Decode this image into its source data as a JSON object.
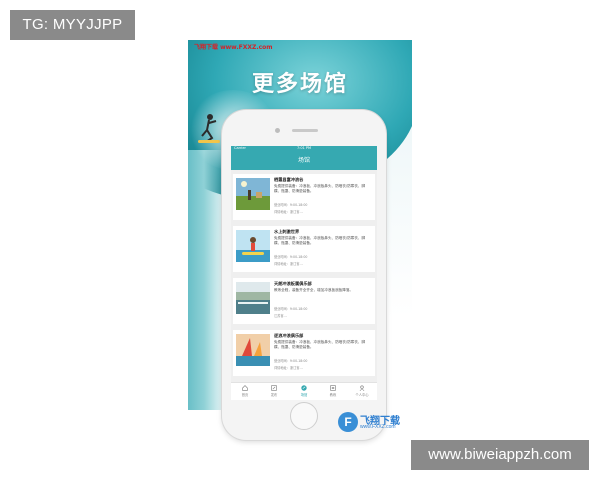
{
  "watermark_top": "TG: MYYJJPP",
  "watermark_bottom": "www.biweiappzh.com",
  "poster": {
    "brand": "飞翔下载 www.FXXZ.com",
    "headline": "更多场馆"
  },
  "status_bar": {
    "carrier": "Carrier",
    "time": "7:01 PM"
  },
  "nav_title": "场馆",
  "venues": [
    {
      "title": "栖霞县富冲浪谷",
      "desc": "免费提供装备：冲浪板、冲浪板鼻头、防晒衣/防寒衣、脚蹼、瓶罩、防滑垫装备。",
      "hours": "营业时间：9:00-18:00",
      "address": "详情地址：浙江省…"
    },
    {
      "title": "水上刺激世界",
      "desc": "免费提供装备：冲浪板、冲浪板鼻头、防晒衣/防寒衣、脚蹼、瓶罩、防滑垫装备。",
      "hours": "营业时间：9:00-18:00",
      "address": "详情地址：浙江省…"
    },
    {
      "title": "天朗冲浪板属俱乐部",
      "desc": "教练全程，装备齐全齐全，增加冲浪板浪板降落。",
      "hours": "营业时间：9:00-18:00",
      "address": "江苏省…"
    },
    {
      "title": "逐浪冲浪俱乐部",
      "desc": "免费提供装备：冲浪板、冲浪板鼻头、防晒衣/防寒衣、脚蹼、瓶罩、防滑垫装备。",
      "hours": "营业时间：9:00-18:00",
      "address": "详情地址：浙江省…"
    }
  ],
  "tabs": [
    {
      "label": "首页",
      "icon": "home-icon"
    },
    {
      "label": "发布",
      "icon": "edit-icon"
    },
    {
      "label": "场馆",
      "icon": "venue-icon"
    },
    {
      "label": "教练",
      "icon": "coach-icon"
    },
    {
      "label": "个人中心",
      "icon": "user-icon"
    }
  ],
  "logo": {
    "name": "飞翔下载",
    "url": "www.FXXZ.com"
  },
  "colors": {
    "accent": "#36a9b1",
    "wave": "#2fa8b5"
  }
}
